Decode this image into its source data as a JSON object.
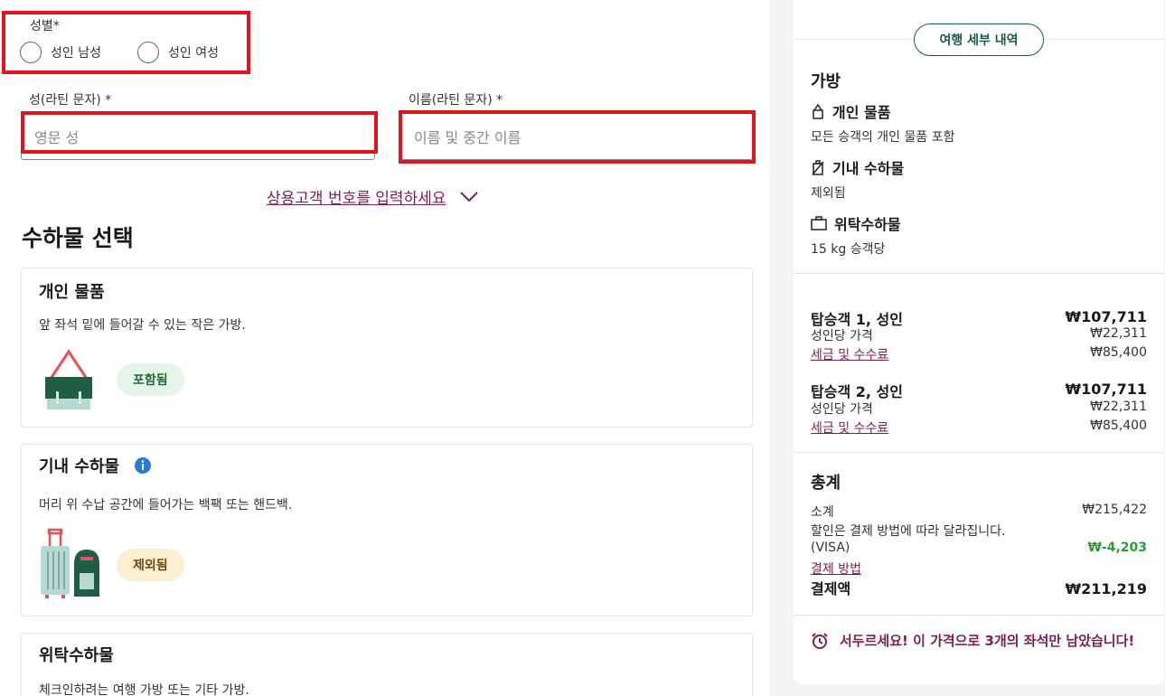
{
  "form": {
    "gender_label": "성별*",
    "gender_male": "성인 남성",
    "gender_female": "성인 여성",
    "last_name_label": "성(라틴 문자) *",
    "last_name_placeholder": "영문 성",
    "first_name_label": "이름(라틴 문자) *",
    "first_name_placeholder": "이름 및 중간 이름",
    "frequent_flyer_link": "상용고객 번호를 입력하세요"
  },
  "baggage": {
    "section_title": "수하물 선택",
    "personal": {
      "title": "개인 물품",
      "desc": "앞 좌석 밑에 들어갈 수 있는 작은 가방.",
      "badge": "포함됨"
    },
    "carry_on": {
      "title": "기내 수하물",
      "desc": "머리 위 수납 공간에 들어가는 백팩 또는 핸드백.",
      "badge": "제외됨"
    },
    "checked": {
      "title": "위탁수하물",
      "desc": "체크인하려는 여행 가방 또는 기타 가방."
    }
  },
  "summary": {
    "trip_details_button": "여행 세부 내역",
    "bag_heading": "가방",
    "personal_title": "개인 물품",
    "personal_text": "모든 승객의 개인 물품 포함",
    "carry_title": "기내 수하물",
    "carry_text": "제외됨",
    "checked_title": "위탁수하물",
    "checked_text": "15 kg 승객당",
    "pax1": {
      "title": "탑승객 1, 성인",
      "total": "₩107,711",
      "fare_label": "성인당 가격",
      "fare": "₩22,311",
      "tax_label": "세금 및 수수료",
      "tax": "₩85,400"
    },
    "pax2": {
      "title": "탑승객 2, 성인",
      "total": "₩107,711",
      "fare_label": "성인당 가격",
      "fare": "₩22,311",
      "tax_label": "세금 및 수수료",
      "tax": "₩85,400"
    },
    "total_heading": "총계",
    "subtotal_label": "소계",
    "subtotal": "₩215,422",
    "discount_note": "할인은 결제 방법에 따라 달라집니다.",
    "visa_label": "(VISA)",
    "visa_discount": "₩-4,203",
    "payment_method_link": "결제 방법",
    "amount_due_label": "결제액",
    "amount_due": "₩211,219",
    "hurry_text": "서두르세요! 이 가격으로 3개의 좌석만 남았습니다!"
  },
  "colors": {
    "accent": "#7a1f55",
    "brand_green": "#1c5b45",
    "highlight_red": "#e0141e",
    "discount_green": "#2f9a3a"
  }
}
